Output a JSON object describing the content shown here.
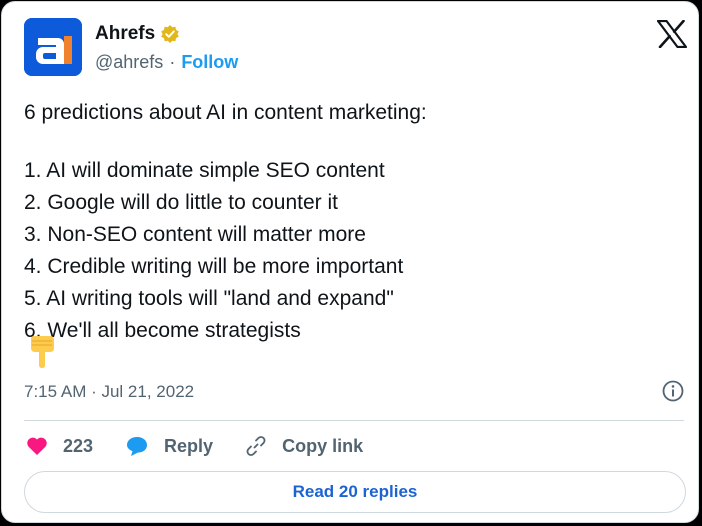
{
  "author": {
    "display_name": "Ahrefs",
    "handle": "@ahrefs",
    "separator": "·",
    "follow_label": "Follow",
    "avatar_letter": "a",
    "avatar_color": "#0d5bdb",
    "avatar_accent": "#f0812d",
    "verified_badge_color": "#e2b719"
  },
  "tweet": {
    "lines": [
      "6 predictions about AI in content marketing:",
      "1. AI will dominate simple SEO content",
      "2. Google will do little to counter it",
      "3. Non-SEO content will matter more",
      "4. Credible writing will be more important",
      "5. AI writing tools will \"land and expand\"",
      "6. We'll all become strategists"
    ],
    "emoji": "backhand-index-pointing-down",
    "timestamp": "7:15 AM · Jul 21, 2022"
  },
  "actions": {
    "like_count": "223",
    "reply_label": "Reply",
    "copy_link_label": "Copy link",
    "like_color": "#f91880",
    "reply_color": "#1d9bf0"
  },
  "footer": {
    "read_replies_label": "Read 20 replies"
  },
  "icons": {
    "brand": "x-logo-icon",
    "info": "info-icon"
  }
}
